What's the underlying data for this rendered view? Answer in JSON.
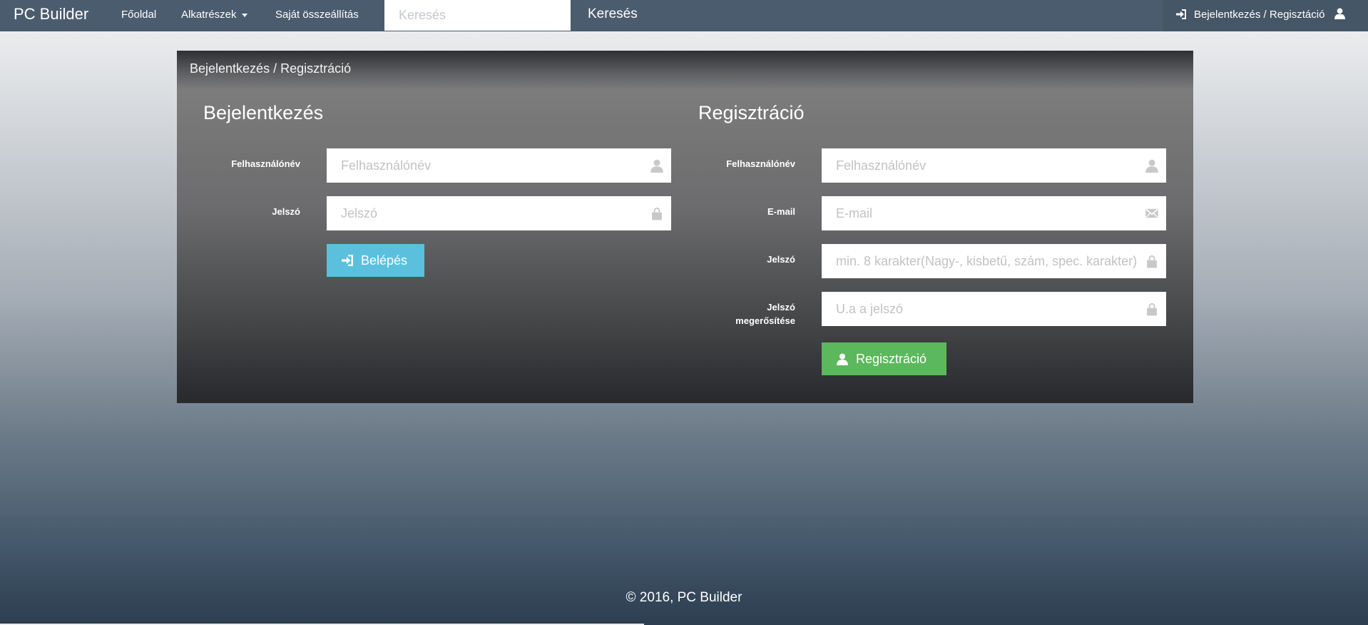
{
  "navbar": {
    "brand": "PC Builder",
    "links": [
      "Főoldal",
      "Alkatrészek",
      "Saját összeállítás"
    ],
    "search_placeholder": "Keresés",
    "search_button": "Keresés",
    "login_label": "Bejelentkezés / Regisztáció"
  },
  "panel": {
    "heading": "Bejelentkezés / Regisztráció",
    "login": {
      "title": "Bejelentkezés",
      "username_label": "Felhasználónév",
      "username_placeholder": "Felhasználónév",
      "password_label": "Jelszó",
      "password_placeholder": "Jelszó",
      "submit": "Belépés"
    },
    "register": {
      "title": "Regisztráció",
      "username_label": "Felhasználónév",
      "username_placeholder": "Felhasználónév",
      "email_label": "E-mail",
      "email_placeholder": "E-mail",
      "password_label": "Jelszó",
      "password_placeholder": "min. 8 karakter(Nagy-, kisbetű, szám, spec. karakter)",
      "confirm_label_1": "Jelszó",
      "confirm_label_2": "megerősítése",
      "confirm_placeholder": "U.a a jelszó",
      "submit": "Regisztráció"
    }
  },
  "footer": {
    "text": "© 2016, PC Builder"
  },
  "colors": {
    "navbar": "#4b5c6e",
    "btn_info": "#5bc0de",
    "btn_success": "#5cb85c"
  },
  "icons": [
    "log-in-icon",
    "user-icon",
    "lock-icon",
    "envelope-icon"
  ]
}
